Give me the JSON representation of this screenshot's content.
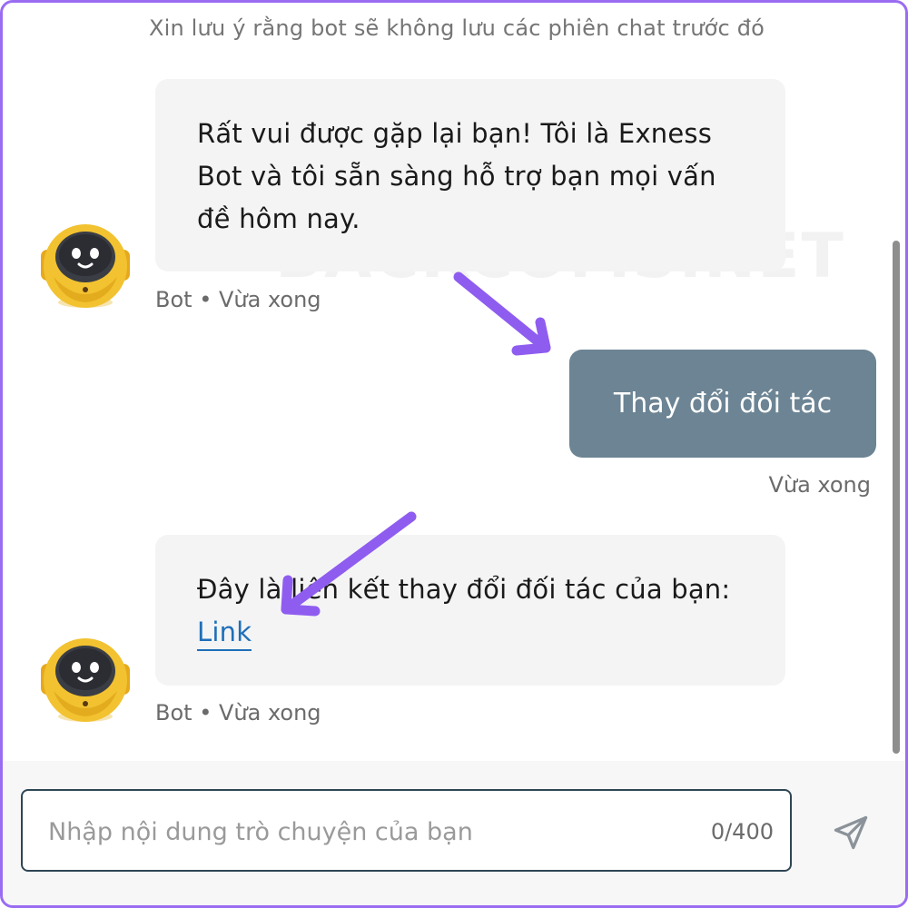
{
  "notice": "Xin lưu ý rằng bot sẽ không lưu các phiên chat trước đó",
  "watermark": "BACKCOMS.NET",
  "messages": {
    "bot1": {
      "lines": [
        "Rất vui được gặp lại bạn! Tôi là Exness",
        "Bot và tôi sẵn sàng hỗ trợ bạn mọi vấn",
        "đề hôm nay."
      ],
      "meta": "Bot • Vừa xong"
    },
    "user1": {
      "text": "Thay đổi đối tác",
      "meta": "Vừa xong"
    },
    "bot2": {
      "text": "Đây là liên kết thay đổi đối tác của bạn:",
      "link": "Link",
      "meta": "Bot • Vừa xong"
    }
  },
  "composer": {
    "placeholder": "Nhập nội dung trò chuyện của bạn",
    "value": "",
    "counter": "0/400"
  },
  "colors": {
    "frame_border": "#9a6cf2",
    "annotation_arrow": "#8f5cf0",
    "user_bubble": "#6c8494",
    "bot_bubble": "#f4f4f5",
    "link": "#1f6fb8",
    "avatar": "#f2c230"
  },
  "icons": {
    "avatar": "robot-avatar-icon",
    "send": "paper-plane-send-icon"
  }
}
